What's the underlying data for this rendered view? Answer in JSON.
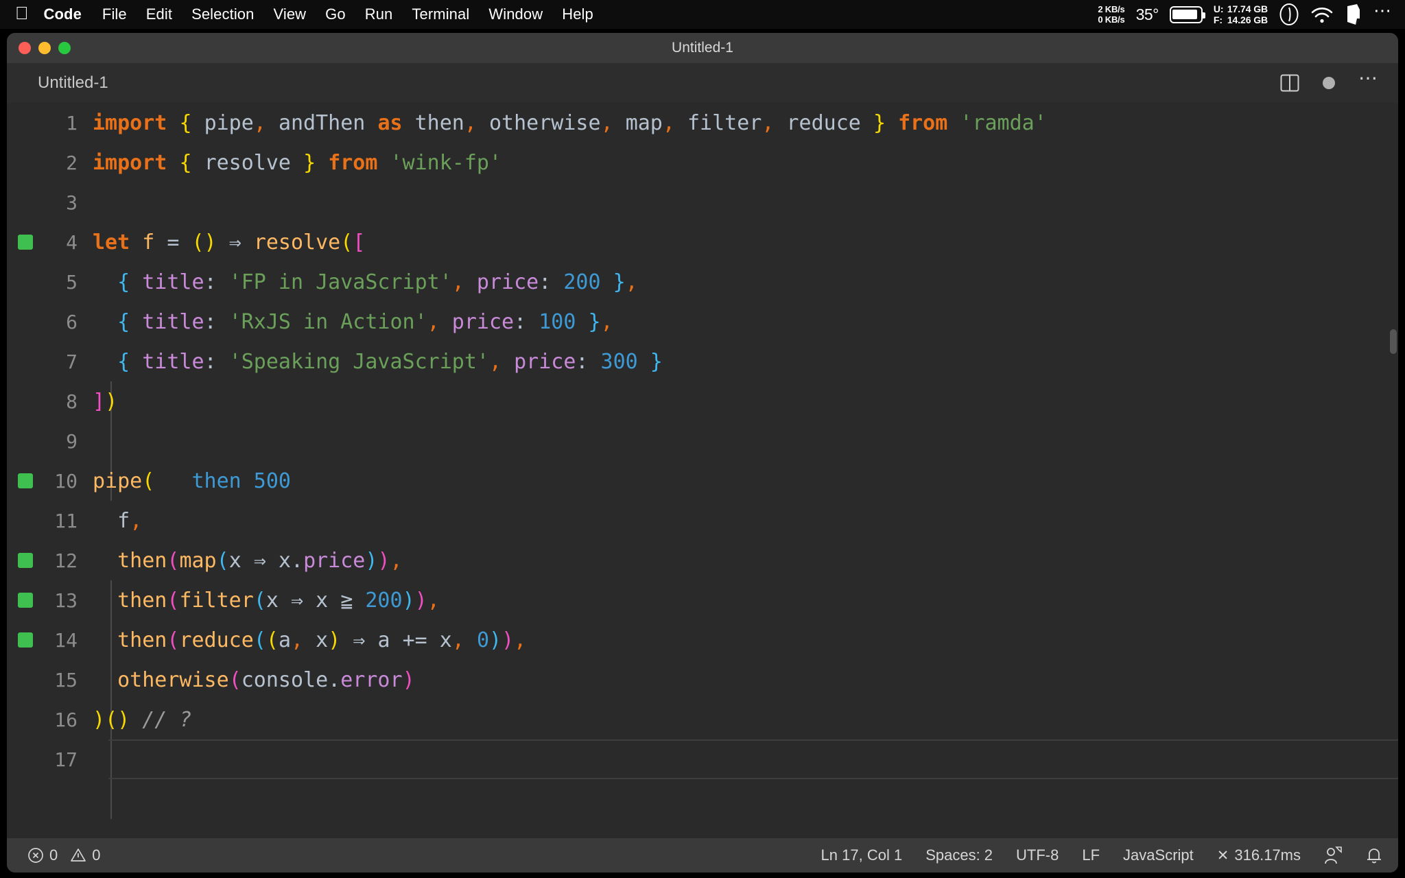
{
  "menubar": {
    "apple_glyph": "apple-logo",
    "items": [
      {
        "label": "Code",
        "bold": true
      },
      {
        "label": "File",
        "bold": false
      },
      {
        "label": "Edit",
        "bold": false
      },
      {
        "label": "Selection",
        "bold": false
      },
      {
        "label": "View",
        "bold": false
      },
      {
        "label": "Go",
        "bold": false
      },
      {
        "label": "Run",
        "bold": false
      },
      {
        "label": "Terminal",
        "bold": false
      },
      {
        "label": "Window",
        "bold": false
      },
      {
        "label": "Help",
        "bold": false
      }
    ],
    "status": {
      "net_up": "2 KB/s",
      "net_down": "0 KB/s",
      "temperature": "35°",
      "disk_used_label": "U:",
      "disk_used_value": "17.74 GB",
      "disk_free_label": "F:",
      "disk_free_value": "14.26 GB",
      "icons": [
        "battery-icon",
        "clock-icon",
        "wifi-icon",
        "app-icon",
        "control-center-icon"
      ]
    }
  },
  "window": {
    "title": "Untitled-1",
    "traffic_lights": [
      "close-button",
      "minimize-button",
      "maximize-button"
    ]
  },
  "tabrow": {
    "tab_label": "Untitled-1",
    "actions": [
      "split-editor-icon",
      "unsaved-dot-icon",
      "more-actions-icon"
    ]
  },
  "editor": {
    "language_mode": "JavaScript",
    "colors": {
      "background": "#2a2a2a",
      "keyword": "#e8711a",
      "string": "#6ba05a",
      "number": "#3e9ad4",
      "function": "#fdb863",
      "property": "#c98bd9",
      "plain": "#b6c2cf",
      "comment": "#9a9a9a",
      "bracket1": "#f7d800",
      "bracket2": "#ef4fc0",
      "bracket3": "#3fb7ef",
      "breakpoint": "#3fbf4f"
    },
    "lines": [
      {
        "num": "1",
        "breakpoint": false
      },
      {
        "num": "2",
        "breakpoint": false
      },
      {
        "num": "3",
        "breakpoint": false
      },
      {
        "num": "4",
        "breakpoint": true
      },
      {
        "num": "5",
        "breakpoint": false
      },
      {
        "num": "6",
        "breakpoint": false
      },
      {
        "num": "7",
        "breakpoint": false
      },
      {
        "num": "8",
        "breakpoint": false
      },
      {
        "num": "9",
        "breakpoint": false
      },
      {
        "num": "10",
        "breakpoint": true
      },
      {
        "num": "11",
        "breakpoint": false
      },
      {
        "num": "12",
        "breakpoint": true
      },
      {
        "num": "13",
        "breakpoint": true
      },
      {
        "num": "14",
        "breakpoint": true
      },
      {
        "num": "15",
        "breakpoint": false
      },
      {
        "num": "16",
        "breakpoint": false
      },
      {
        "num": "17",
        "breakpoint": false
      }
    ],
    "source_text": [
      "import { pipe, andThen as then, otherwise, map, filter, reduce } from 'ramda'",
      "import { resolve } from 'wink-fp'",
      "",
      "let f = () => resolve([",
      "  { title: 'FP in JavaScript', price: 200 },",
      "  { title: 'RxJS in Action', price: 100 },",
      "  { title: 'Speaking JavaScript', price: 300 }",
      "])",
      "",
      "pipe(",
      "  f,",
      "  then(map(x => x.price)),",
      "  then(filter(x => x >= 200)),",
      "  then(reduce((a, x) => a += x, 0)),",
      "  otherwise(console.error)",
      ")() // ?",
      ""
    ],
    "inline_hint": {
      "line": "10",
      "text": "then 500"
    }
  },
  "statusbar": {
    "errors_icon": "error-circle-icon",
    "errors_count": "0",
    "warnings_icon": "warning-triangle-icon",
    "warnings_count": "0",
    "cursor_position": "Ln 17, Col 1",
    "indentation": "Spaces: 2",
    "encoding": "UTF-8",
    "eol": "LF",
    "language": "JavaScript",
    "runtime_icon": "close-x-icon",
    "runtime": "316.17ms",
    "remote_icon": "account-icon",
    "notification_icon": "bell-icon"
  }
}
